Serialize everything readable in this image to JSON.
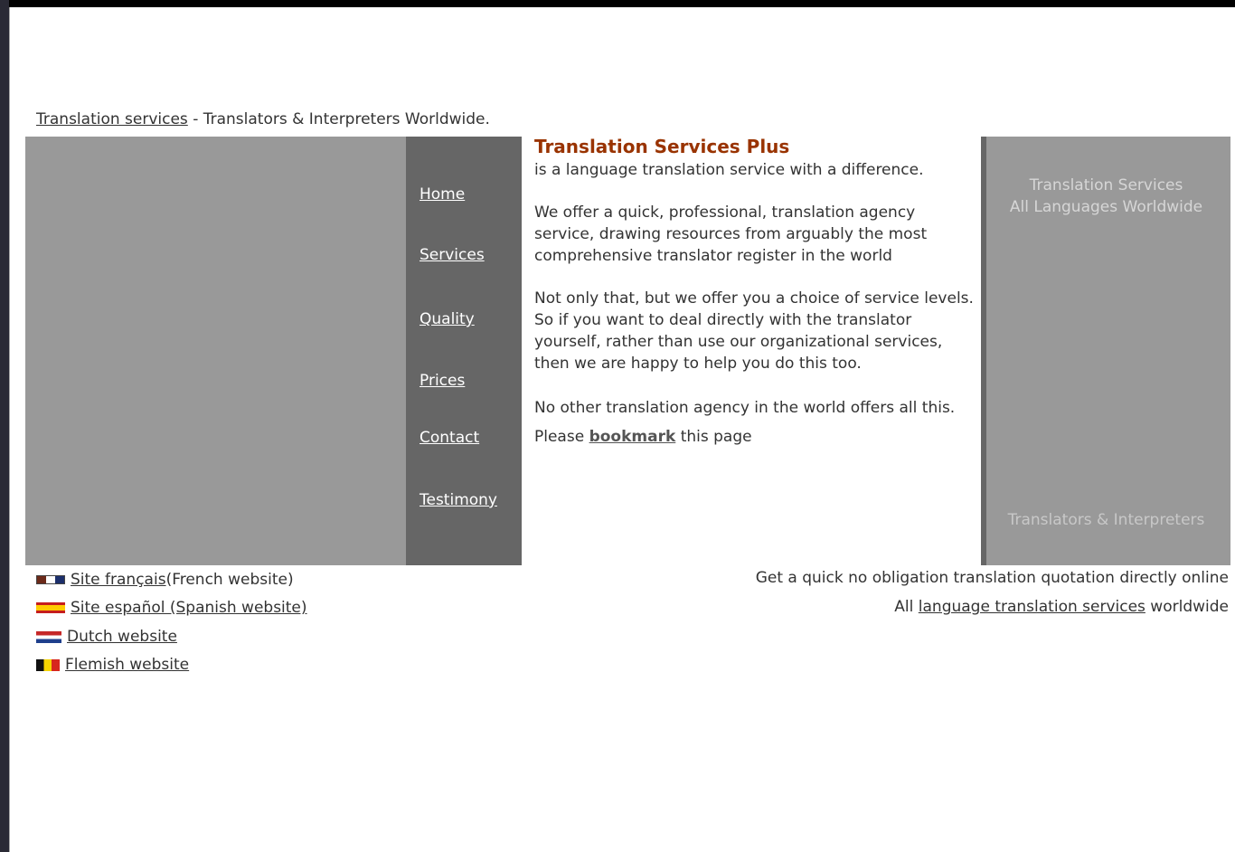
{
  "header": {
    "tagline_link": "Translation services",
    "tagline_rest": " - Translators & Interpreters Worldwide."
  },
  "nav": {
    "items": [
      "Home",
      "Services",
      "Quality",
      "Prices",
      "Contact",
      "Testimony"
    ]
  },
  "main": {
    "title": "Translation Services Plus",
    "intro": "is a language translation service with a difference.",
    "para1": "We offer a quick, professional, translation agency service, drawing resources from arguably the most comprehensive translator register in the world",
    "para2": "Not only that, but we offer you a choice of service levels. So if you want to deal directly with the translator yourself, rather than use our organizational services, then we are happy to help you do this too.",
    "para3": "No other translation agency in the world offers all this.",
    "bookmark_pre": "Please ",
    "bookmark_link": "bookmark",
    "bookmark_post": " this page"
  },
  "side_panel": {
    "line1": "Translation Services",
    "line2": "All Languages Worldwide",
    "bottom": "Translators & Interpreters"
  },
  "languages": [
    {
      "icon": "flag-france-icon",
      "link": "Site français",
      "note": " (French website)"
    },
    {
      "icon": "flag-spain-icon",
      "link": "Site español (Spanish website)",
      "note": ""
    },
    {
      "icon": "flag-netherlands-icon",
      "link": "Dutch website",
      "note": ""
    },
    {
      "icon": "flag-belgium-icon",
      "link": "Flemish website",
      "note": ""
    }
  ],
  "footer_right": {
    "quote_text": "Get a quick no obligation translation quotation directly online",
    "services_pre": "All ",
    "services_link": "language translation services",
    "services_post": " worldwide"
  },
  "colors": {
    "title": "#993300",
    "nav_bg": "#666666",
    "panel_bg": "#999999"
  }
}
